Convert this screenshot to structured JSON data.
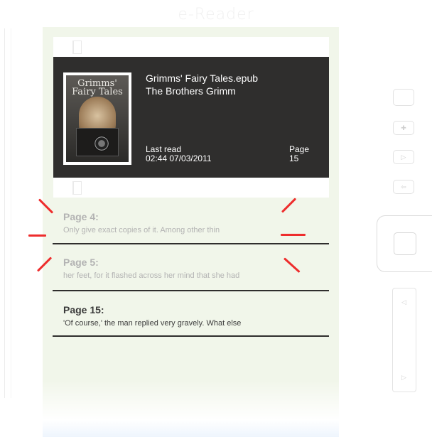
{
  "brand": "e-Reader",
  "book": {
    "title": "Grimms' Fairy Tales.epub",
    "author": "The Brothers Grimm",
    "cover_text": "Grimms' Fairy Tales",
    "last_read_label": "Last read",
    "last_read_value": "02:44 07/03/2011",
    "page_label": "Page",
    "page_value": "15"
  },
  "bookmarks": [
    {
      "title": "Page 4:",
      "snippet": "Only give exact copies of it. Among other thin",
      "state": "faded"
    },
    {
      "title": "Page 5:",
      "snippet": "her feet, for it flashed across her mind that she had",
      "state": "faded"
    },
    {
      "title": "Page 15:",
      "snippet": "'Of course,' the man replied very gravely. What else",
      "state": "normal"
    }
  ],
  "hardware_buttons": [
    {
      "name": "menu-button",
      "icon": "blank"
    },
    {
      "name": "bookmark-button",
      "icon": "bookmark-icon",
      "glyph": "✚"
    },
    {
      "name": "forward-button",
      "icon": "play-icon",
      "glyph": "▷"
    },
    {
      "name": "back-button",
      "icon": "back-icon",
      "glyph": "⇦"
    }
  ],
  "page_rocker": {
    "up_glyph": "◁",
    "down_glyph": "▷"
  },
  "colors": {
    "screen": "#f1f6ea",
    "card": "#2f2e2d",
    "highlight_ray": "#ee2d2d",
    "faded_text": "#b3b3b3"
  }
}
